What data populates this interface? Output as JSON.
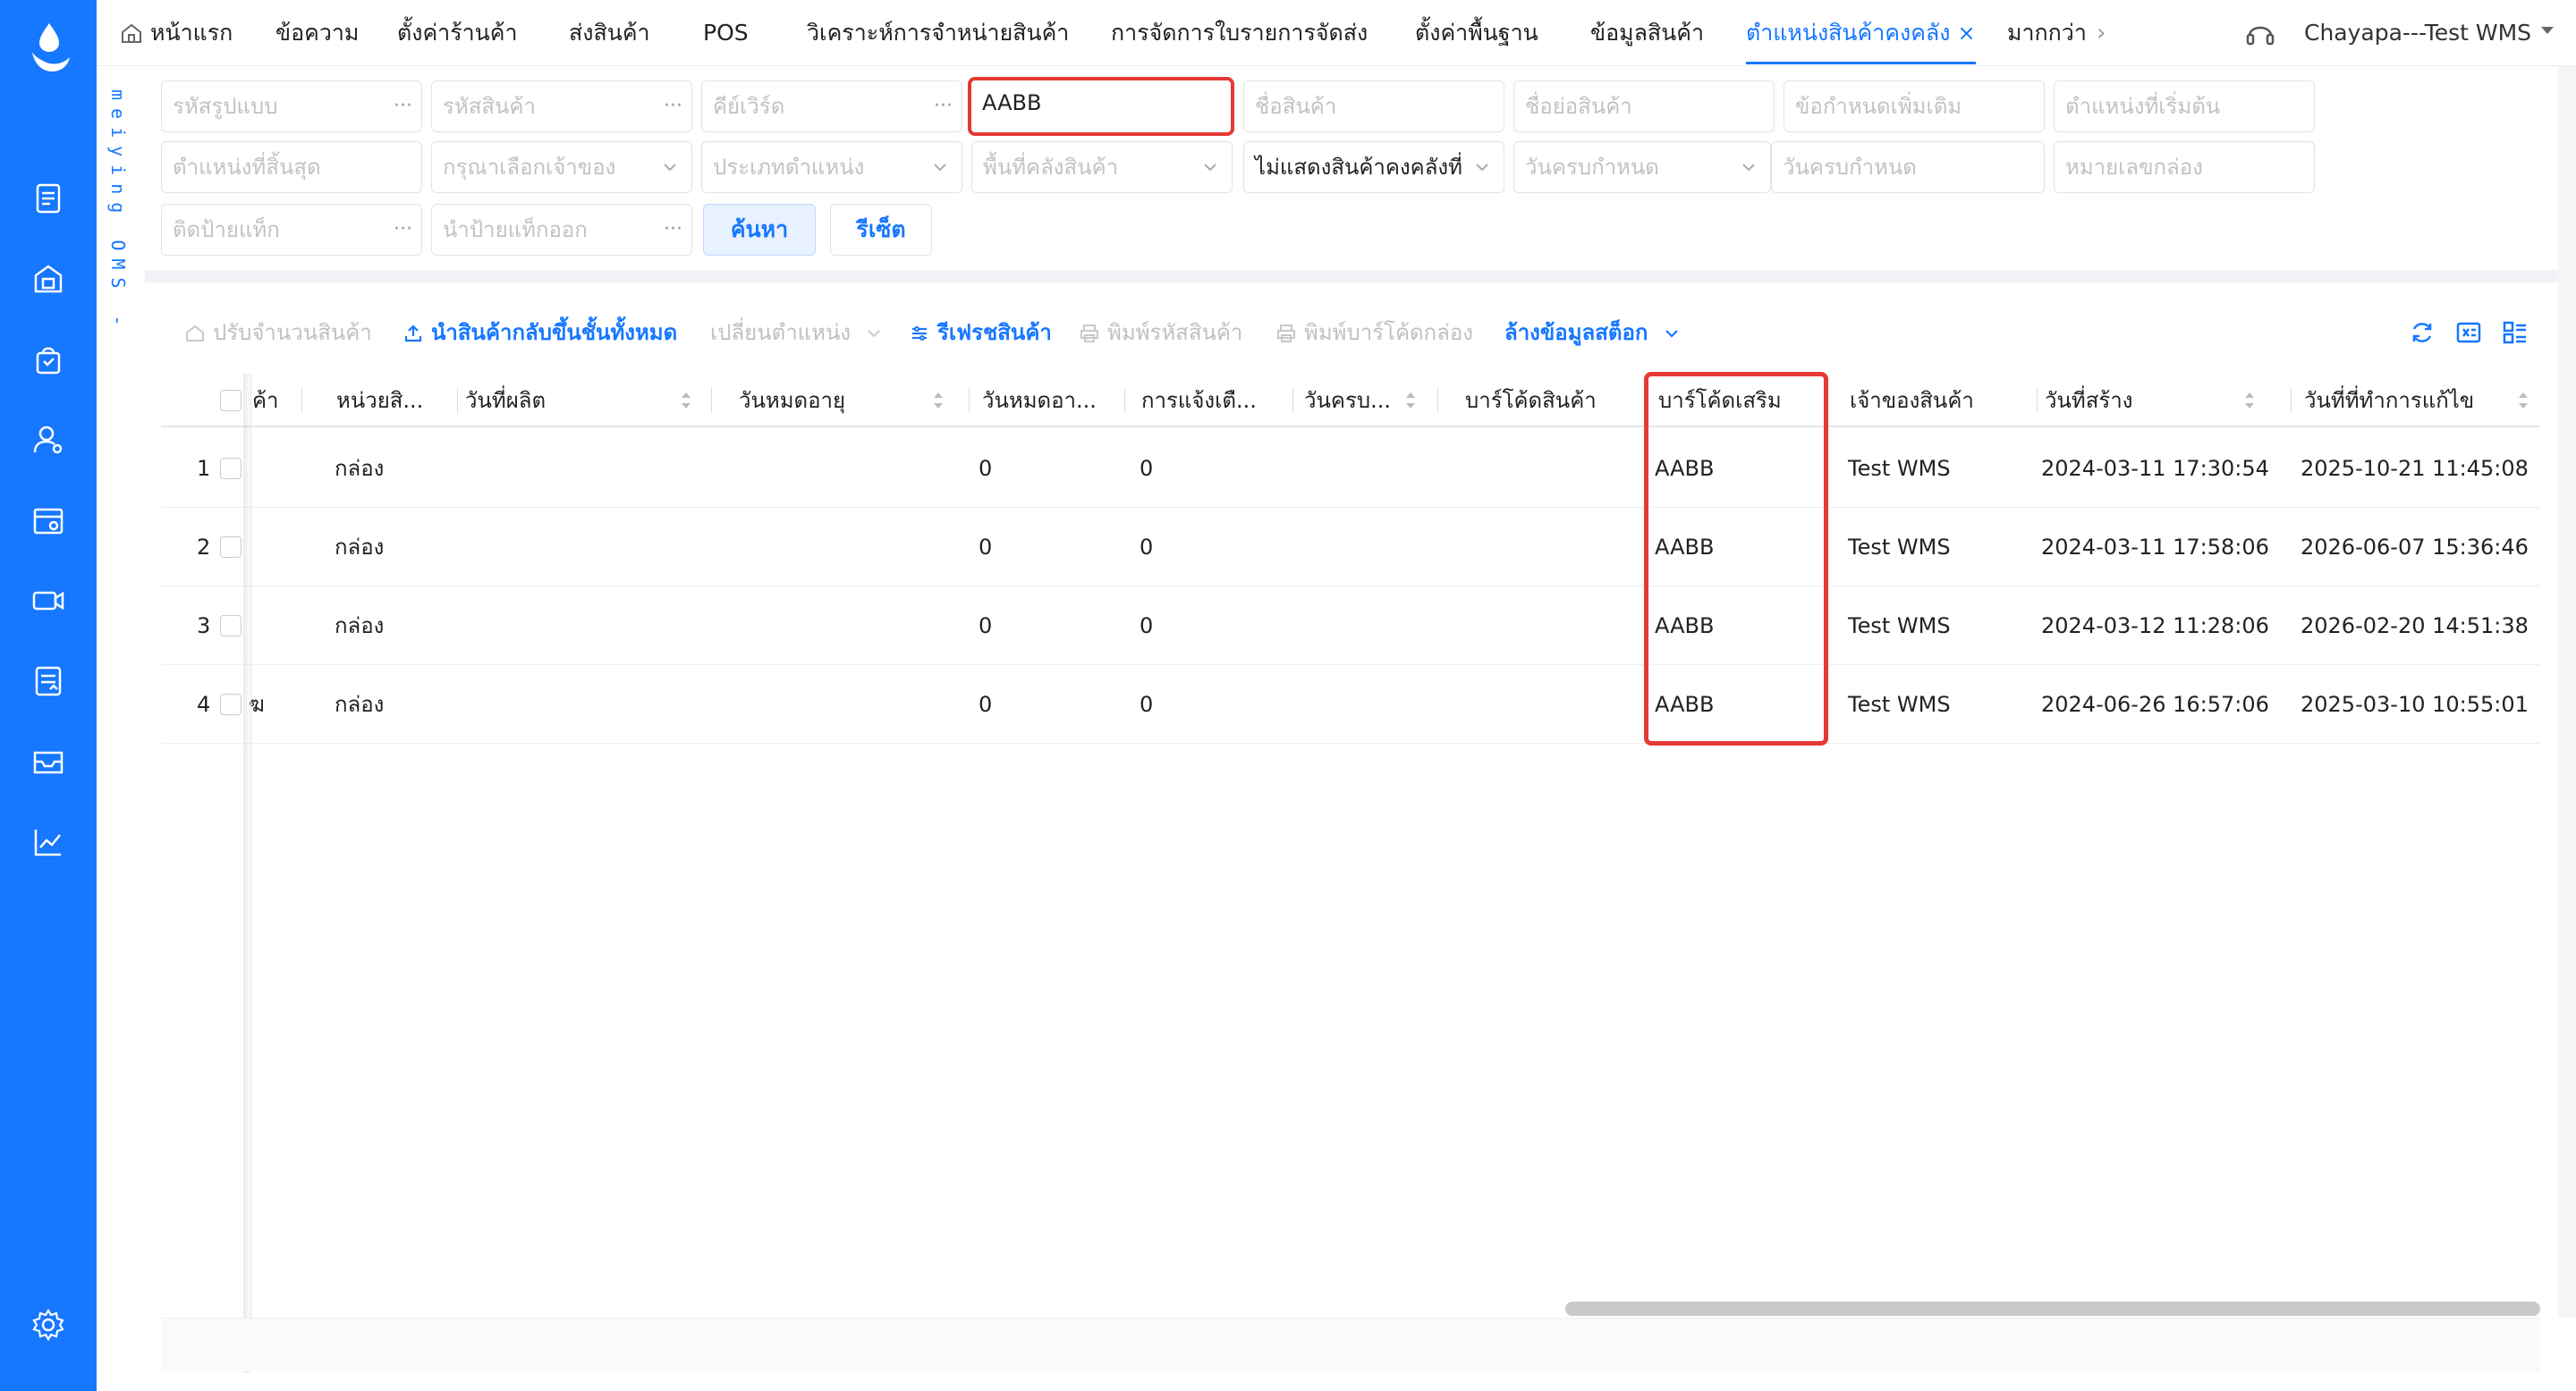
{
  "brand": {
    "strip_text": "meiying OMS -"
  },
  "top_tabs": [
    {
      "label": "หน้าแรก"
    },
    {
      "label": "ข้อความ"
    },
    {
      "label": "ตั้งค่าร้านค้า"
    },
    {
      "label": "ส่งสินค้า"
    },
    {
      "label": "POS"
    },
    {
      "label": "วิเคราะห์การจำหน่ายสินค้า"
    },
    {
      "label": "การจัดการใบรายการจัดส่ง"
    },
    {
      "label": "ตั้งค่าพื้นฐาน"
    },
    {
      "label": "ข้อมูลสินค้า"
    },
    {
      "label": "ตำแหน่งสินค้าคงคลัง",
      "close": "×"
    },
    {
      "label": "มากกว่า"
    }
  ],
  "user": {
    "name": "Chayapa---Test WMS"
  },
  "filters": {
    "row1": [
      {
        "placeholder": "รหัสรูปแบบ",
        "suffix": "···"
      },
      {
        "placeholder": "รหัสสินค้า",
        "suffix": "···"
      },
      {
        "placeholder": "คีย์เวิร์ด",
        "suffix": "···"
      },
      {
        "value": "AABB"
      },
      {
        "placeholder": "ชื่อสินค้า"
      },
      {
        "placeholder": "ชื่อย่อสินค้า"
      },
      {
        "placeholder": "ข้อกำหนดเพิ่มเติม"
      },
      {
        "placeholder": "ตำแหน่งที่เริ่มต้น"
      }
    ],
    "row2": [
      {
        "placeholder": "ตำแหน่งที่สิ้นสุด"
      },
      {
        "placeholder": "กรุณาเลือกเจ้าของ"
      },
      {
        "placeholder": "ประเภทตำแหน่ง"
      },
      {
        "placeholder": "พื้นที่คลังสินค้า"
      },
      {
        "value": "ไม่แสดงสินค้าคงคลังที่"
      },
      {
        "placeholder": "วันครบกำหนด"
      },
      {
        "placeholder": "วันครบกำหนด"
      },
      {
        "placeholder": "หมายเลขกล่อง"
      }
    ],
    "row3": [
      {
        "placeholder": "ติดป้ายแท็ก",
        "suffix": "···"
      },
      {
        "placeholder": "นำป้ายแท็กออก",
        "suffix": "···"
      }
    ],
    "search_label": "ค้นหา",
    "reset_label": "รีเซ็ต"
  },
  "toolbar": {
    "adjust_qty": "ปรับจำนวนสินค้า",
    "restock_all": "นำสินค้ากลับขึ้นชั้นทั้งหมด",
    "change_location": "เปลี่ยนตำแหน่ง",
    "refresh_products": "รีเฟรชสินค้า",
    "print_product_code": "พิมพ์รหัสสินค้า",
    "print_box_barcode": "พิมพ์บาร์โค้ดกล่อง",
    "clear_stock": "ล้างข้อมูลสต็อก"
  },
  "table": {
    "headers": {
      "product": "ค้า",
      "unit": "หน่วยสิ...",
      "mfg_date": "วันที่ผลิต",
      "expiry": "วันหมดอายุ",
      "expiry2": "วันหมดอา...",
      "notify": "การแจ้งเตื...",
      "due": "วันครบ...",
      "barcode": "บาร์โค้ดสินค้า",
      "extra_barcode": "บาร์โค้ดเสริม",
      "owner": "เจ้าของสินค้า",
      "created": "วันที่สร้าง",
      "modified": "วันที่ที่ทำการแก้ไข"
    },
    "rows": [
      {
        "no": "1",
        "product": "",
        "unit": "กล่อง",
        "expiry2": "0",
        "notify": "0",
        "extra_barcode": "AABB",
        "owner": "Test WMS",
        "created": "2024-03-11 17:30:54",
        "modified": "2025-10-21 11:45:08"
      },
      {
        "no": "2",
        "product": "",
        "unit": "กล่อง",
        "expiry2": "0",
        "notify": "0",
        "extra_barcode": "AABB",
        "owner": "Test WMS",
        "created": "2024-03-11 17:58:06",
        "modified": "2026-06-07 15:36:46"
      },
      {
        "no": "3",
        "product": "",
        "unit": "กล่อง",
        "expiry2": "0",
        "notify": "0",
        "extra_barcode": "AABB",
        "owner": "Test WMS",
        "created": "2024-03-12 11:28:06",
        "modified": "2026-02-20 14:51:38"
      },
      {
        "no": "4",
        "product": "ฆ",
        "unit": "กล่อง",
        "expiry2": "0",
        "notify": "0",
        "extra_barcode": "AABB",
        "owner": "Test WMS",
        "created": "2024-06-26 16:57:06",
        "modified": "2025-03-10 10:55:01"
      }
    ]
  },
  "icons": {
    "logo": "drop-logo-icon",
    "rail": [
      "document-icon",
      "store-icon",
      "bag-icon",
      "user-settings-icon",
      "shop-settings-icon",
      "camera-icon",
      "report-icon",
      "inbox-icon",
      "chart-icon",
      "gear-icon"
    ]
  },
  "colors": {
    "primary": "#1677ff",
    "highlight": "#e53935"
  }
}
